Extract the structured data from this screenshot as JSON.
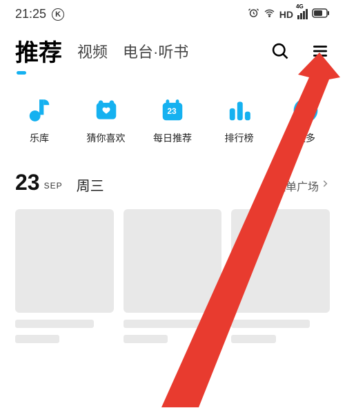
{
  "status": {
    "time": "21:25",
    "k_label": "K",
    "hd_label": "HD",
    "net_label": "4G"
  },
  "nav": {
    "tabs": [
      {
        "label": "推荐",
        "active": true
      },
      {
        "label": "视频",
        "active": false
      },
      {
        "label": "电台·听书",
        "active": false
      }
    ]
  },
  "quick": {
    "items": [
      {
        "label": "乐库",
        "icon": "music-library-icon"
      },
      {
        "label": "猜你喜欢",
        "icon": "heart-card-icon"
      },
      {
        "label": "每日推荐",
        "icon": "calendar-icon",
        "badge": "23"
      },
      {
        "label": "排行榜",
        "icon": "chart-bars-icon"
      },
      {
        "label": "更多",
        "icon": "more-dots-icon"
      }
    ]
  },
  "date": {
    "day": "23",
    "month": "SEP",
    "weekday": "周三",
    "link_label": "歌单广场"
  },
  "annotation": {
    "arrow_color": "#e83b2f"
  }
}
